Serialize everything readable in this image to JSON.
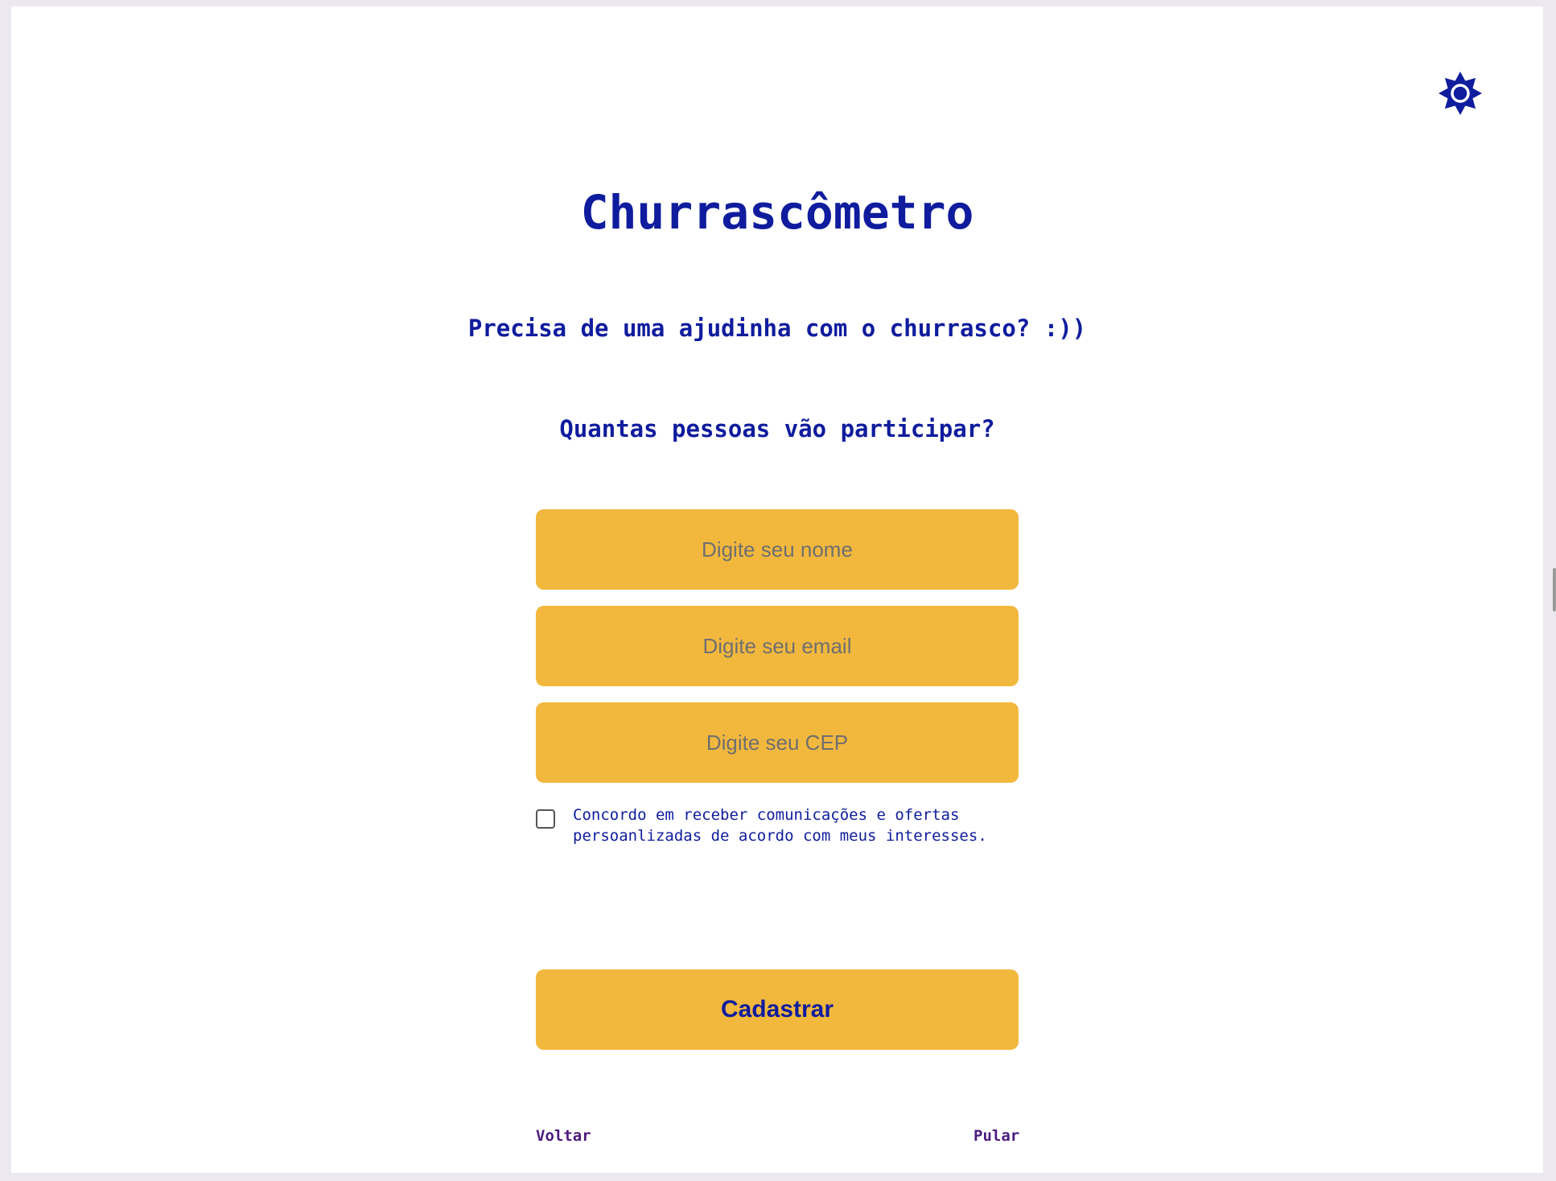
{
  "app": {
    "title": "Churrascômetro",
    "subtitle": "Precisa de uma ajudinha com o churrasco? :))",
    "question": "Quantas pessoas vão participar?"
  },
  "theme_toggle": {
    "icon": "sun-icon",
    "color": "#0f1c9e"
  },
  "form": {
    "name_field": {
      "placeholder": "Digite seu nome",
      "value": ""
    },
    "email_field": {
      "placeholder": "Digite seu email",
      "value": ""
    },
    "cep_field": {
      "placeholder": "Digite seu CEP",
      "value": ""
    },
    "consent": {
      "checked": false,
      "label_line1": "Concordo em receber comunicações e ofertas",
      "label_line2": "persoanlizadas de acordo com meus interesses."
    },
    "submit_label": "Cadastrar"
  },
  "navigation": {
    "back_label": "Voltar",
    "skip_label": "Pular"
  },
  "colors": {
    "accent": "#f2b83e",
    "primary_text": "#0f1c9e",
    "link_text": "#4b1a80",
    "background": "#ffffff"
  }
}
